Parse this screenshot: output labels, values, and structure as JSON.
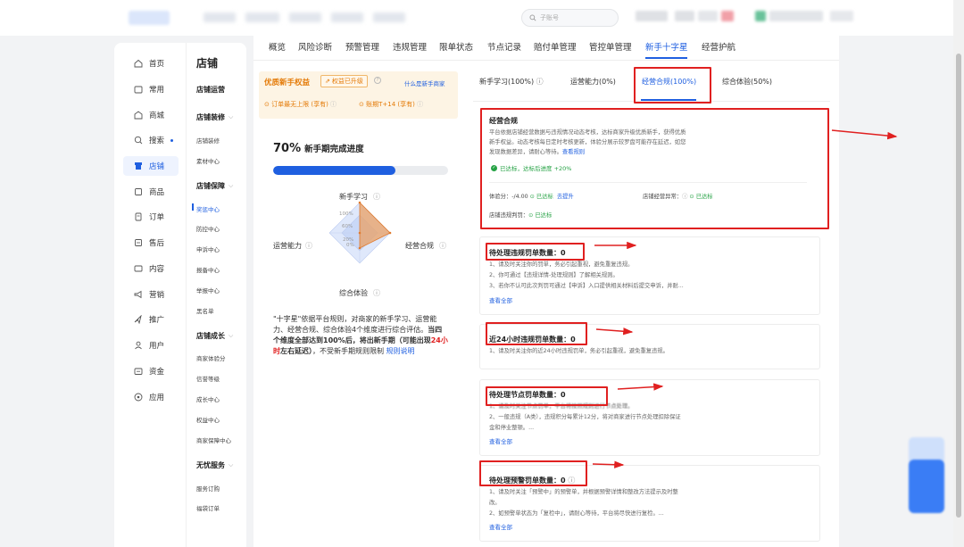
{
  "header": {
    "search_placeholder": "子账号"
  },
  "primary_nav": [
    {
      "label": "首页",
      "icon": "home-icon"
    },
    {
      "label": "常用",
      "icon": "folder-icon"
    },
    {
      "label": "商城",
      "icon": "shop-icon"
    },
    {
      "label": "搜索",
      "icon": "search-icon"
    },
    {
      "label": "店铺",
      "icon": "store-icon"
    },
    {
      "label": "商品",
      "icon": "goods-icon"
    },
    {
      "label": "订单",
      "icon": "order-icon"
    },
    {
      "label": "售后",
      "icon": "aftersale-icon"
    },
    {
      "label": "内容",
      "icon": "content-icon"
    },
    {
      "label": "营销",
      "icon": "marketing-icon"
    },
    {
      "label": "推广",
      "icon": "promote-icon"
    },
    {
      "label": "用户",
      "icon": "user-icon"
    },
    {
      "label": "资金",
      "icon": "money-icon"
    },
    {
      "label": "应用",
      "icon": "apps-icon"
    }
  ],
  "secondary_nav": {
    "title": "店铺",
    "groups": [
      {
        "label": "店铺运营",
        "items": []
      },
      {
        "label": "店铺装修",
        "items": [
          "店铺装修",
          "素材中心"
        ]
      },
      {
        "label": "店铺保障",
        "items": [
          "奖惩中心",
          "防控中心",
          "申诉中心",
          "报备中心",
          "举报中心",
          "黑名单"
        ]
      },
      {
        "label": "店铺成长",
        "items": [
          "商家体验分",
          "信誉等级",
          "成长中心",
          "权益中心",
          "商家保障中心"
        ]
      },
      {
        "label": "无忧服务",
        "items": [
          "服务订购",
          "福袋订单"
        ]
      }
    ]
  },
  "tabs": [
    "概览",
    "风险诊断",
    "预警管理",
    "违规管理",
    "限单状态",
    "节点记录",
    "赔付单管理",
    "管控单管理",
    "新手十字星",
    "经营护航"
  ],
  "active_tab": "新手十字星",
  "benefit": {
    "title": "优质新手权益",
    "badge": "权益已升级",
    "link": "什么是新手商家",
    "item1": "订单最无上限 (享有)",
    "item2": "账期T+14 (享有)"
  },
  "progress": {
    "percent_label": "70%",
    "label": "新手期完成进度",
    "value": 0.7
  },
  "radar": {
    "axes": [
      "新手学习",
      "经营合规",
      "综合体验",
      "运营能力"
    ],
    "values": [
      100,
      100,
      50,
      0
    ],
    "ticks": [
      "100%",
      "60%",
      "20%",
      "0%"
    ]
  },
  "description": {
    "part1": "\"十字星\"依据平台规则，对商家的新手学习、运营能力、经营合规、综合体验4个维度进行综合评估。",
    "bold1": "当四个维度全部达到100%后，将出新手期（可能出现",
    "red": "24小时",
    "bold2": "左右延迟）",
    "part2": "，不受新手期规则限制",
    "link": "规则说明"
  },
  "subtabs": [
    {
      "label": "新手学习(100%)"
    },
    {
      "label": "运营能力(0%)"
    },
    {
      "label": "经营合规(100%)"
    },
    {
      "label": "综合体验(50%)"
    }
  ],
  "compliance": {
    "title": "经营合规",
    "line1": "平台依据店铺经营数据与违规情况动态考核，达标商家升级优质新手，获得优质",
    "line2": "新手权益。动态考核每日定时考核更新，体验分展示较罗盘可能存在延迟，如您",
    "line3_text": "发现数据差异，请耐心等待。",
    "line3_link": "查看规则",
    "status": "已达标，达标后进度 +20%",
    "score_label": "体验分：-/4.00",
    "score_status": "已达标",
    "score_link": "去提升",
    "abnormal_label": "店铺经营异常：",
    "abnormal_status": "已达标",
    "penalty_label": "店铺违规判罚：",
    "penalty_status": "已达标"
  },
  "cards": [
    {
      "title": "待处理违规罚单数量：0",
      "lines": [
        "1、请及时关注你的罚单，务必引起重视，避免重复违规。",
        "2、你可通过【违规详情-处理规则】了解相关规则。",
        "3、若你不认可此次判罚可通过【申诉】入口提供相关材料后提交申诉，并耐..."
      ],
      "link": "查看全部"
    },
    {
      "title": "近24小时违规罚单数量：0",
      "lines": [
        "1、请及时关注你的近24小时违规罚单，务必引起重视，避免重复违规。"
      ],
      "link": ""
    },
    {
      "title": "待处理节点罚单数量：0",
      "lines": [
        "1、请及时关注节点罚单，平台将按照规则进行节点处理。",
        "2、一般违规（A类），违规积分每累计12分，将对商家进行节点处理扣除保证",
        "金和停业整顿。..."
      ],
      "link": "查看全部"
    },
    {
      "title": "待处理预警罚单数量：0",
      "lines": [
        "1、请及时关注「预警中」的预警单，并根据预警详情和整改方法提示及时整",
        "改。",
        "2、如预警单状态为「复检中」，请耐心等待，平台将尽快进行复检。..."
      ],
      "link": "查看全部"
    }
  ],
  "colors": {
    "accent": "#1f5fe0",
    "warning": "#e47a07",
    "success": "#25a244",
    "alert_red": "#e02020"
  }
}
